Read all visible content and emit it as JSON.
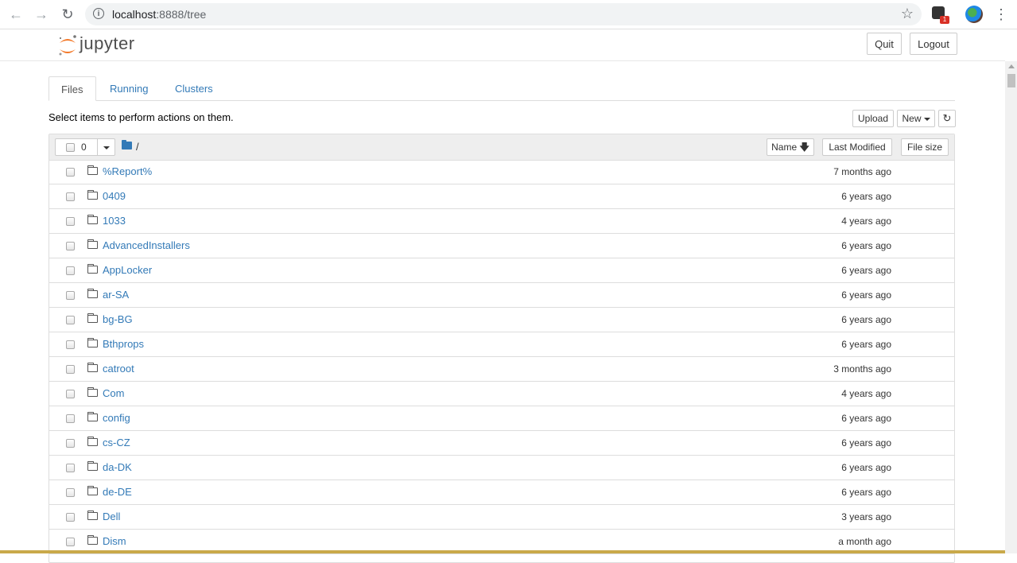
{
  "browser": {
    "url_host": "localhost",
    "url_port": ":8888",
    "url_path": "/tree",
    "extension_badge": "1"
  },
  "header": {
    "logo_text": "jupyter",
    "quit_label": "Quit",
    "logout_label": "Logout"
  },
  "tabs": [
    {
      "label": "Files",
      "active": true
    },
    {
      "label": "Running",
      "active": false
    },
    {
      "label": "Clusters",
      "active": false
    }
  ],
  "toolbar": {
    "hint": "Select items to perform actions on them.",
    "upload_label": "Upload",
    "new_label": "New",
    "refresh_icon": "refresh-icon"
  },
  "list_header": {
    "selected_count": "0",
    "breadcrumb": "/",
    "sort_name": "Name",
    "sort_modified": "Last Modified",
    "sort_size": "File size"
  },
  "files": [
    {
      "name": "%Report%",
      "modified": "7 months ago"
    },
    {
      "name": "0409",
      "modified": "6 years ago"
    },
    {
      "name": "1033",
      "modified": "4 years ago"
    },
    {
      "name": "AdvancedInstallers",
      "modified": "6 years ago"
    },
    {
      "name": "AppLocker",
      "modified": "6 years ago"
    },
    {
      "name": "ar-SA",
      "modified": "6 years ago"
    },
    {
      "name": "bg-BG",
      "modified": "6 years ago"
    },
    {
      "name": "Bthprops",
      "modified": "6 years ago"
    },
    {
      "name": "catroot",
      "modified": "3 months ago"
    },
    {
      "name": "Com",
      "modified": "4 years ago"
    },
    {
      "name": "config",
      "modified": "6 years ago"
    },
    {
      "name": "cs-CZ",
      "modified": "6 years ago"
    },
    {
      "name": "da-DK",
      "modified": "6 years ago"
    },
    {
      "name": "de-DE",
      "modified": "6 years ago"
    },
    {
      "name": "Dell",
      "modified": "3 years ago"
    },
    {
      "name": "Dism",
      "modified": "a month ago"
    }
  ],
  "colors": {
    "link": "#337ab7",
    "logo_orange": "#f37726",
    "border": "#dddddd"
  }
}
